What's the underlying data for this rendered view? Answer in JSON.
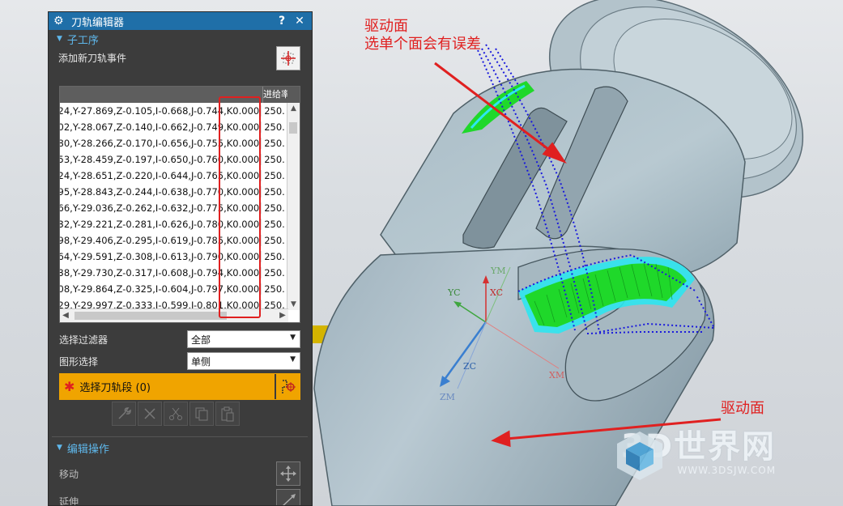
{
  "dialog": {
    "title": "刀轨编辑器",
    "help_label": "?",
    "close_label": "✕",
    "section_suboperation": "子工序",
    "add_event_label": "添加新刀轨事件",
    "table": {
      "col_feed": "进给率",
      "rows": [
        {
          "text": "24,Y-27.869,Z-0.105,I-0.668,J-0.744,K0.000",
          "feed": "250."
        },
        {
          "text": "02,Y-28.067,Z-0.140,I-0.662,J-0.749,K0.000",
          "feed": "250."
        },
        {
          "text": "80,Y-28.266,Z-0.170,I-0.656,J-0.755,K0.000",
          "feed": "250."
        },
        {
          "text": "53,Y-28.459,Z-0.197,I-0.650,J-0.760,K0.000",
          "feed": "250."
        },
        {
          "text": "24,Y-28.651,Z-0.220,I-0.644,J-0.765,K0.000",
          "feed": "250."
        },
        {
          "text": "95,Y-28.843,Z-0.244,I-0.638,J-0.770,K0.000",
          "feed": "250."
        },
        {
          "text": "66,Y-29.036,Z-0.262,I-0.632,J-0.775,K0.000",
          "feed": "250."
        },
        {
          "text": "32,Y-29.221,Z-0.281,I-0.626,J-0.780,K0.000",
          "feed": "250."
        },
        {
          "text": "98,Y-29.406,Z-0.295,I-0.619,J-0.785,K0.000",
          "feed": "250."
        },
        {
          "text": "64,Y-29.591,Z-0.308,I-0.613,J-0.790,K0.000",
          "feed": "250."
        },
        {
          "text": "38,Y-29.730,Z-0.317,I-0.608,J-0.794,K0.000",
          "feed": "250."
        },
        {
          "text": "08,Y-29.864,Z-0.325,I-0.604,J-0.797,K0.000",
          "feed": "250."
        },
        {
          "text": "29,Y-29.997,Z-0.333,I-0.599,J-0.801,K0.000",
          "feed": "250."
        }
      ]
    },
    "filter_label": "选择过滤器",
    "filter_value": "全部",
    "shape_label": "图形选择",
    "shape_value": "单侧",
    "select_segment_label": "选择刀轨段 (0)",
    "section_edit": "编辑操作",
    "move_label": "移动",
    "extend_label": "延伸"
  },
  "annotations": {
    "drive_face_top": "驱动面",
    "single_face_note": "选单个面会有误差",
    "drive_face_bottom": "驱动面"
  },
  "triad": {
    "yc": "YC",
    "xc": "XC",
    "zc": "ZC",
    "ym": "YM",
    "xm": "XM",
    "zm": "ZM"
  },
  "watermark": {
    "brand": "3D世界网",
    "url": "WWW.3DSJW.COM"
  },
  "colors": {
    "title_bar": "#1f6fa8",
    "section_text": "#5fb8ec",
    "dialog_bg": "#3c3c3c",
    "highlight_orange": "#f0a400",
    "annotation_red": "#e02020",
    "toolpath_blue": "#1a1adc",
    "toolpath_green": "#1fd82a",
    "toolpath_cyan": "#2ee6f0"
  }
}
